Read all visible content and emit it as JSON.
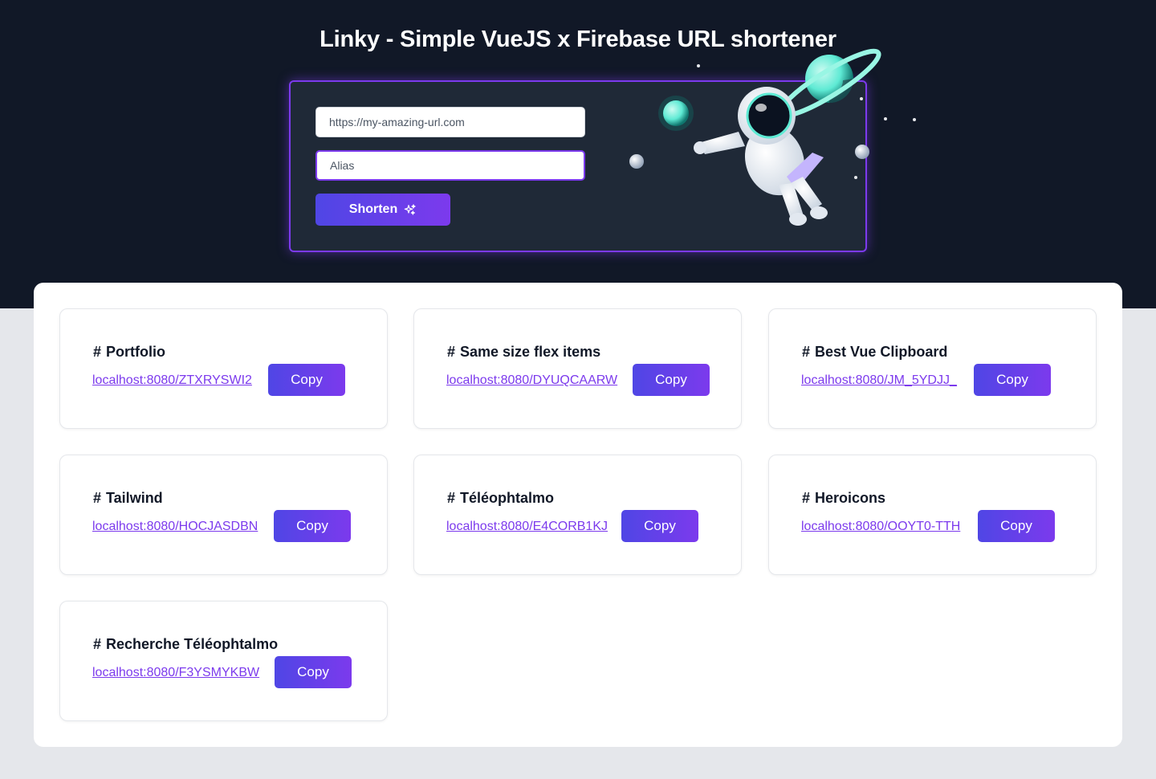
{
  "header": {
    "title": "Linky - Simple VueJS x Firebase URL shortener"
  },
  "form": {
    "url_placeholder": "https://my-amazing-url.com",
    "alias_placeholder": "Alias",
    "shorten_label": "Shorten",
    "shorten_icon": "sparkles-icon",
    "illustration": "astronaut-planet-illustration"
  },
  "links": [
    {
      "name": "Portfolio",
      "url": "localhost:8080/ZTXRYSWI2",
      "copy_label": "Copy"
    },
    {
      "name": "Same size flex items",
      "url": "localhost:8080/DYUQCAARW",
      "copy_label": "Copy"
    },
    {
      "name": "Best Vue Clipboard",
      "url": "localhost:8080/JM_5YDJJ_",
      "copy_label": "Copy"
    },
    {
      "name": "Tailwind",
      "url": "localhost:8080/HOCJASDBN",
      "copy_label": "Copy"
    },
    {
      "name": "Téléophtalmo",
      "url": "localhost:8080/E4CORB1KJ",
      "copy_label": "Copy"
    },
    {
      "name": "Heroicons",
      "url": "localhost:8080/OOYT0-TTH",
      "copy_label": "Copy"
    },
    {
      "name": "Recherche Téléophtalmo",
      "url": "localhost:8080/F3YSMYKBW",
      "copy_label": "Copy"
    }
  ],
  "colors": {
    "hero_background": "#111827",
    "card_background": "#1f2937",
    "accent": "#7c3aed",
    "accent_start": "#4f46e5",
    "page_background": "#e5e7eb"
  }
}
